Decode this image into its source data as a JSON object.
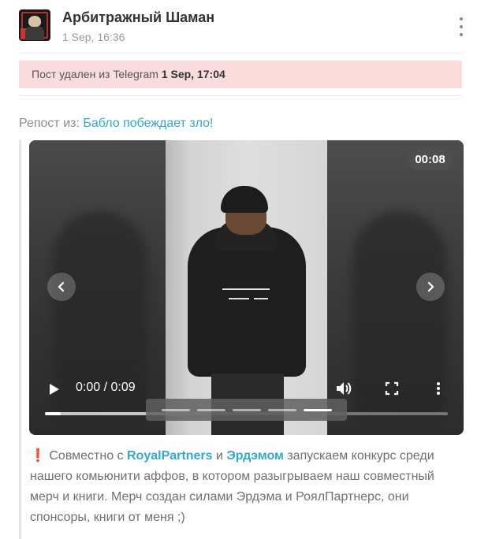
{
  "post": {
    "channel_name": "Арбитражный Шаман",
    "time": "1 Sep, 16:36",
    "menu_icon": "vertical-dots-icon"
  },
  "deleted_banner": {
    "text": "Пост удален из Telegram ",
    "date": "1 Sep, 17:04",
    "background": "#fbdcdc"
  },
  "repost": {
    "label": "Репост из: ",
    "source": "Бабло побеждает зло!"
  },
  "video": {
    "duration_badge": "00:08",
    "time_display": "0:00 / 0:09",
    "progress_played": 0.0,
    "progress_loaded": 0.4,
    "slides_count": 5,
    "active_slide": 5,
    "icons": {
      "play": "play-icon",
      "volume": "volume-icon",
      "fullscreen": "fullscreen-icon",
      "more": "more-vertical-icon",
      "prev": "chevron-left-icon",
      "next": "chevron-right-icon"
    }
  },
  "text": {
    "emoji": "❗",
    "part1": " Совместно с ",
    "link1": "RoyalPartners",
    "part2": " и ",
    "link2": "Эрдэмом",
    "part3": " запускаем конкурс среди нашего комьюнити аффов, в котором разыгрываем наш совместный мерч и книги. Мерч создан силами Эрдэма и РоялПартнерс, они спонсоры, книги от меня ;)"
  },
  "colors": {
    "link": "#35a7cd",
    "accent_red": "#e23b3b"
  }
}
